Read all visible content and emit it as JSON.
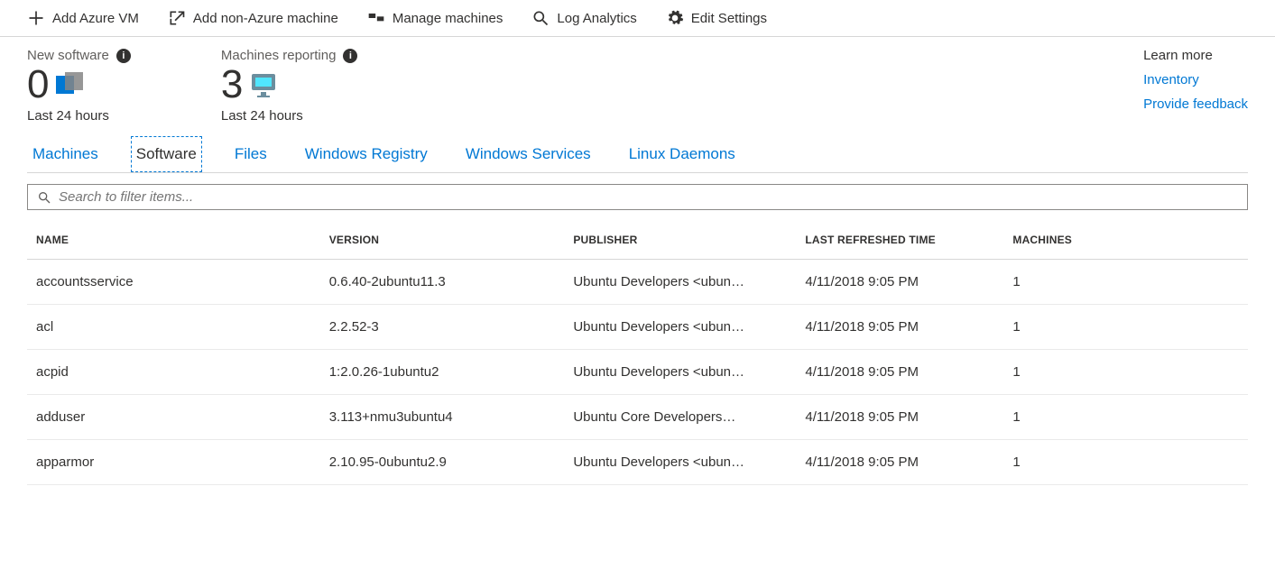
{
  "toolbar": {
    "add_azure_vm": "Add Azure VM",
    "add_non_azure": "Add non-Azure machine",
    "manage_machines": "Manage machines",
    "log_analytics": "Log Analytics",
    "edit_settings": "Edit Settings"
  },
  "stats": {
    "new_software": {
      "label": "New software",
      "value": "0",
      "sub": "Last 24 hours"
    },
    "machines_reporting": {
      "label": "Machines reporting",
      "value": "3",
      "sub": "Last 24 hours"
    }
  },
  "side_links": {
    "heading": "Learn more",
    "inventory": "Inventory",
    "feedback": "Provide feedback"
  },
  "tabs": {
    "machines": "Machines",
    "software": "Software",
    "files": "Files",
    "registry": "Windows Registry",
    "services": "Windows Services",
    "daemons": "Linux Daemons"
  },
  "search": {
    "placeholder": "Search to filter items..."
  },
  "table": {
    "headers": {
      "name": "NAME",
      "version": "VERSION",
      "publisher": "PUBLISHER",
      "refreshed": "LAST REFRESHED TIME",
      "machines": "MACHINES"
    },
    "rows": [
      {
        "name": "accountsservice",
        "version": "0.6.40-2ubuntu11.3",
        "publisher": "Ubuntu Developers <ubun…",
        "refreshed": "4/11/2018 9:05 PM",
        "machines": "1"
      },
      {
        "name": "acl",
        "version": "2.2.52-3",
        "publisher": "Ubuntu Developers <ubun…",
        "refreshed": "4/11/2018 9:05 PM",
        "machines": "1"
      },
      {
        "name": "acpid",
        "version": "1:2.0.26-1ubuntu2",
        "publisher": "Ubuntu Developers <ubun…",
        "refreshed": "4/11/2018 9:05 PM",
        "machines": "1"
      },
      {
        "name": "adduser",
        "version": "3.113+nmu3ubuntu4",
        "publisher": "Ubuntu Core Developers…",
        "refreshed": "4/11/2018 9:05 PM",
        "machines": "1"
      },
      {
        "name": "apparmor",
        "version": "2.10.95-0ubuntu2.9",
        "publisher": "Ubuntu Developers <ubun…",
        "refreshed": "4/11/2018 9:05 PM",
        "machines": "1"
      }
    ]
  }
}
